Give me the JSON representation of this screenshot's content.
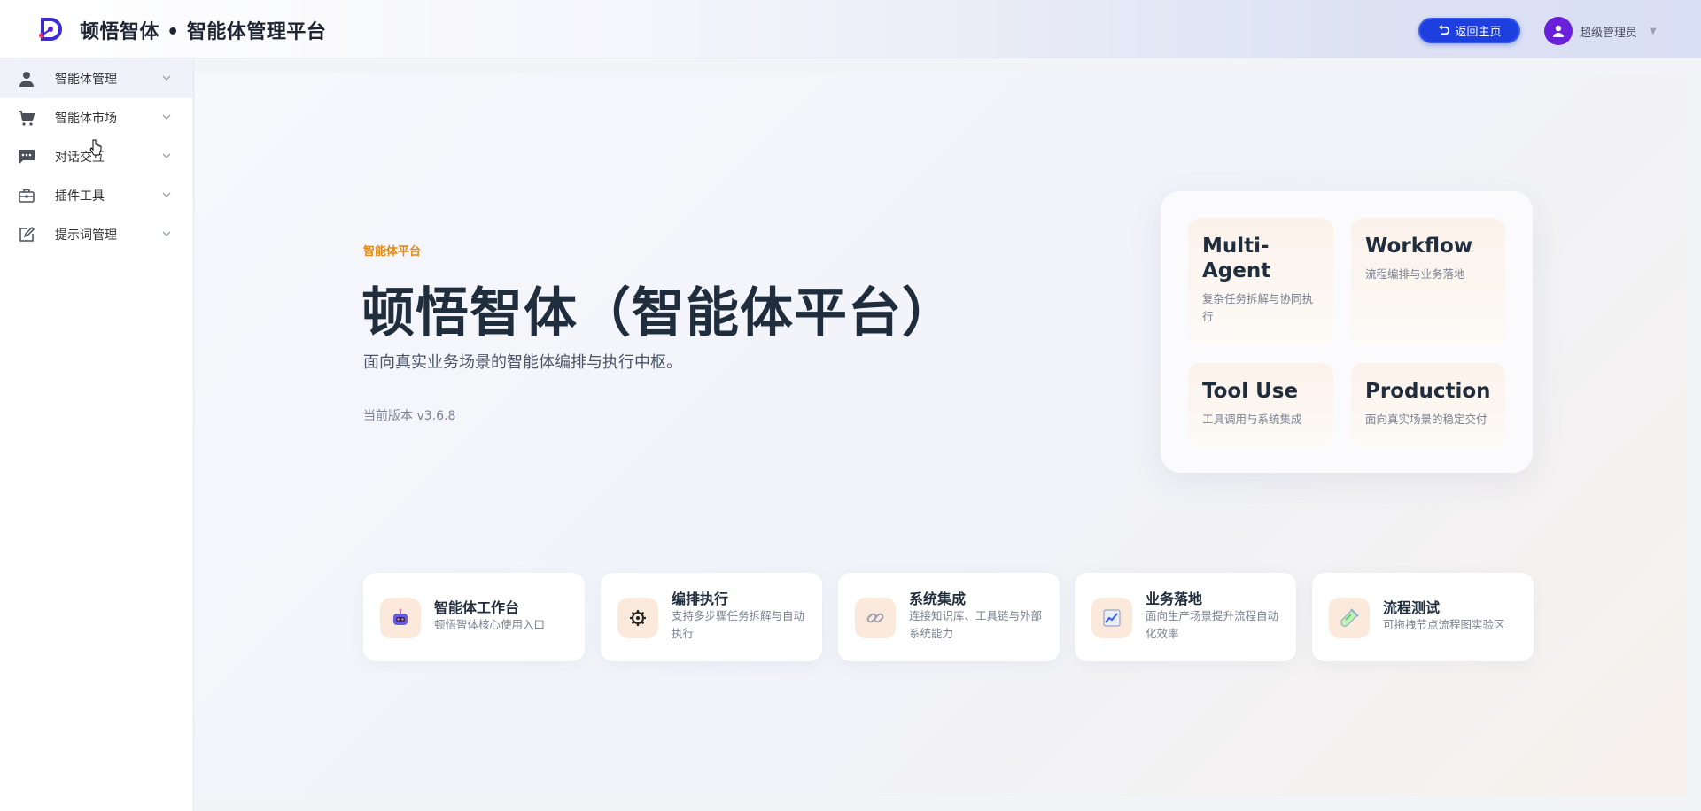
{
  "header": {
    "title": "顿悟智体 • 智能体管理平台",
    "back_label": "返回主页",
    "user_name": "超级管理员"
  },
  "sidebar": {
    "items": [
      {
        "label": "智能体管理",
        "icon": "user-icon",
        "active": true
      },
      {
        "label": "智能体市场",
        "icon": "cart-icon"
      },
      {
        "label": "对话交互",
        "icon": "chat-icon"
      },
      {
        "label": "插件工具",
        "icon": "toolbox-icon"
      },
      {
        "label": "提示词管理",
        "icon": "edit-icon"
      }
    ]
  },
  "hero": {
    "tag": "智能体平台",
    "title": "顿悟智体（智能体平台）",
    "subtitle": "面向真实业务场景的智能体编排与执行中枢。",
    "version": "当前版本 v3.6.8"
  },
  "features": [
    {
      "title": "Multi-Agent",
      "desc": "复杂任务拆解与协同执行"
    },
    {
      "title": "Workflow",
      "desc": "流程编排与业务落地"
    },
    {
      "title": "Tool Use",
      "desc": "工具调用与系统集成"
    },
    {
      "title": "Production",
      "desc": "面向真实场景的稳定交付"
    }
  ],
  "cards": [
    {
      "title": "智能体工作台",
      "desc": "顿悟智体核心使用入口",
      "icon": "robot-icon"
    },
    {
      "title": "编排执行",
      "desc": "支持多步骤任务拆解与自动执行",
      "icon": "gear-icon"
    },
    {
      "title": "系统集成",
      "desc": "连接知识库、工具链与外部系统能力",
      "icon": "link-icon"
    },
    {
      "title": "业务落地",
      "desc": "面向生产场景提升流程自动化效率",
      "icon": "chart-icon"
    },
    {
      "title": "流程测试",
      "desc": "可拖拽节点流程图实验区",
      "icon": "test-tube-icon"
    }
  ],
  "colors": {
    "accent": "#1e3fe0",
    "avatar": "#6a1fd8",
    "tag": "#e08a1c"
  }
}
